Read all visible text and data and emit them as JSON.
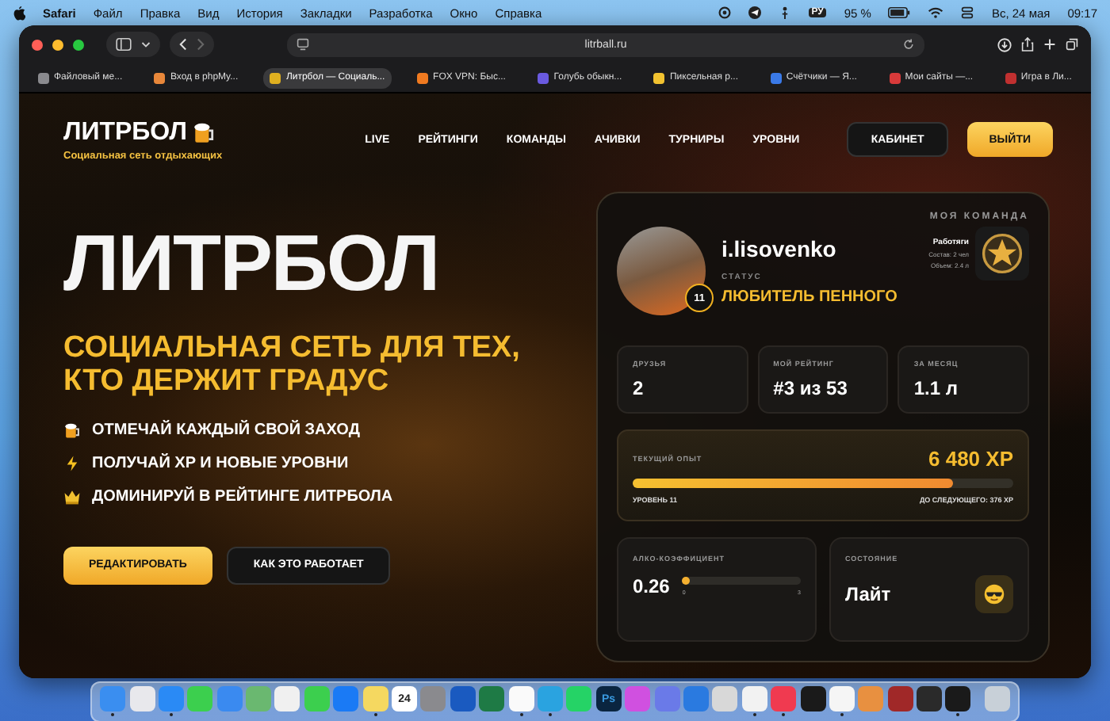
{
  "menubar": {
    "app": "Safari",
    "items": [
      "Файл",
      "Правка",
      "Вид",
      "История",
      "Закладки",
      "Разработка",
      "Окно",
      "Справка"
    ],
    "keyboard": "РУ",
    "battery": "95 %",
    "date": "Вс, 24 мая",
    "time": "09:17"
  },
  "browser": {
    "url": "litrball.ru",
    "tabs": [
      {
        "title": "Файловый ме...",
        "color": "#8a8a8e",
        "selected": false
      },
      {
        "title": "Вход в phpMy...",
        "color": "#e8873a",
        "selected": false
      },
      {
        "title": "Литрбол — Социаль...",
        "color": "#e0b020",
        "selected": true
      },
      {
        "title": "FOX VPN: Быс...",
        "color": "#f07a20",
        "selected": false
      },
      {
        "title": "Голубь обыкн...",
        "color": "#6a5ae0",
        "selected": false
      },
      {
        "title": "Пиксельная р...",
        "color": "#f2c230",
        "selected": false
      },
      {
        "title": "Счётчики — Я...",
        "color": "#3a7ae8",
        "selected": false
      },
      {
        "title": "Мои сайты —...",
        "color": "#d83a3a",
        "selected": false
      },
      {
        "title": "Игра в Ли...",
        "color": "#c03030",
        "selected": false
      }
    ]
  },
  "site": {
    "logo": "ЛИТРБОЛ",
    "slogan": "Социальная сеть отдыхающих",
    "nav": [
      "LIVE",
      "РЕЙТИНГИ",
      "КОМАНДЫ",
      "АЧИВКИ",
      "ТУРНИРЫ",
      "УРОВНИ"
    ],
    "cabinet": "КАБИНЕТ",
    "logout": "ВЫЙТИ"
  },
  "hero": {
    "title": "ЛИТРБОЛ",
    "tagline": [
      "СОЦИАЛЬНАЯ СЕТЬ ДЛЯ ТЕХ,",
      "КТО ДЕРЖИТ ГРАДУС"
    ],
    "features": [
      "ОТМЕЧАЙ КАЖДЫЙ СВОЙ ЗАХОД",
      "ПОЛУЧАЙ XP И НОВЫЕ УРОВНИ",
      "ДОМИНИРУЙ В РЕЙТИНГЕ ЛИТРБОЛА"
    ],
    "buttons": [
      "РЕДАКТИРОВАТЬ",
      "КАК ЭТО РАБОТАЕТ"
    ]
  },
  "profile": {
    "username": "i.lisovenko",
    "level_badge": "11",
    "status_label": "СТАТУС",
    "status": "ЛЮБИТЕЛЬ ПЕННОГО",
    "team": {
      "heading": "МОЯ КОМАНДА",
      "name": "Работяги",
      "members": "Состав: 2 чел",
      "volume": "Объем: 2.4 л"
    },
    "stats": [
      {
        "label": "ДРУЗЬЯ",
        "value": "2"
      },
      {
        "label": "МОЙ РЕЙТИНГ",
        "value": "#3 из 53"
      },
      {
        "label": "ЗА МЕСЯЦ",
        "value": "1.1 л"
      }
    ],
    "xp": {
      "label": "ТЕКУЩИЙ ОПЫТ",
      "value": "6 480 XP",
      "level": 0.84,
      "current_level": "УРОВЕНЬ 11",
      "next": "ДО СЛЕДУЮЩЕГО: 376 XP"
    },
    "alco": {
      "label": "АЛКО-КОЭФФИЦИЕНТ",
      "value": "0.26",
      "level": 0.03,
      "min": "0",
      "max": "3"
    },
    "state": {
      "label": "СОСТОЯНИЕ",
      "value": "Лайт"
    }
  },
  "dock": [
    {
      "color": "#3a8ef0",
      "running": true
    },
    {
      "color": "#e8e8ec",
      "running": false
    },
    {
      "color": "#2a8af5",
      "running": true
    },
    {
      "color": "#3ccf4e",
      "running": false
    },
    {
      "color": "#3a8af0",
      "running": false
    },
    {
      "color": "#6ab870",
      "running": false
    },
    {
      "color": "#f0f0f0",
      "running": false
    },
    {
      "color": "#3ccf4e",
      "running": false
    },
    {
      "color": "#1a7af5",
      "running": false
    },
    {
      "color": "#f5d860",
      "running": true
    },
    {
      "color": "#ffffff",
      "running": false,
      "label": "24"
    },
    {
      "color": "#8a8a8e",
      "running": false
    },
    {
      "color": "#1a5ac0",
      "running": false
    },
    {
      "color": "#1e7a45",
      "running": false
    },
    {
      "color": "#fafafa",
      "running": true
    },
    {
      "color": "#2aa3e0",
      "running": true
    },
    {
      "color": "#25d366",
      "running": false
    },
    {
      "color": "#0a2540",
      "running": false,
      "label": "Ps"
    },
    {
      "color": "#d050e0",
      "running": false
    },
    {
      "color": "#6a7ae8",
      "running": false
    },
    {
      "color": "#2a7ae0",
      "running": false
    },
    {
      "color": "#d8d8d8",
      "running": false
    },
    {
      "color": "#f2f2f2",
      "running": true
    },
    {
      "color": "#f03a50",
      "running": true
    },
    {
      "color": "#1a1a1a",
      "running": false
    },
    {
      "color": "#f5f5f5",
      "running": true
    },
    {
      "color": "#e89040",
      "running": false
    },
    {
      "color": "#a02828",
      "running": false
    },
    {
      "color": "#2a2a2a",
      "running": false
    },
    {
      "color": "#1a1a1a",
      "running": true
    },
    {
      "color": "#c8d0d8",
      "running": false
    }
  ]
}
